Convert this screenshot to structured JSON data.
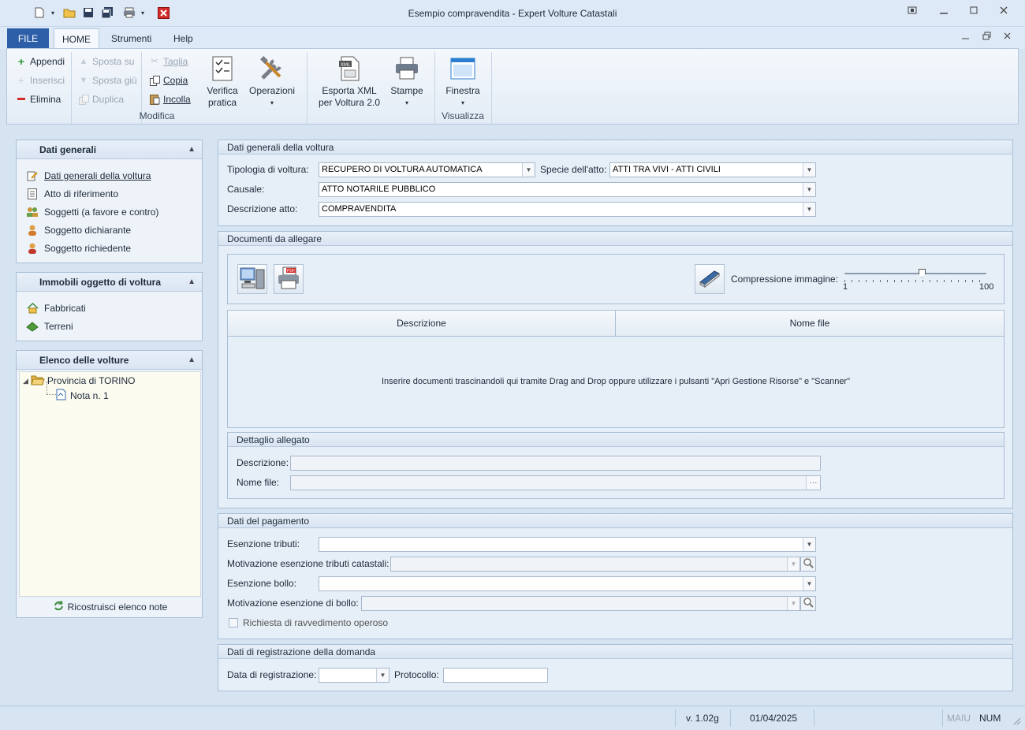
{
  "window": {
    "title": "Esempio compravendita - Expert Volture Catastali",
    "controls": [
      "restore-icon",
      "minimize-icon",
      "maximize-icon",
      "close-icon"
    ]
  },
  "tabs": [
    {
      "label": "FILE"
    },
    {
      "label": "HOME"
    },
    {
      "label": "Strumenti"
    },
    {
      "label": "Help"
    }
  ],
  "ribbon": {
    "appendi": "Appendi",
    "inserisci": "Inserisci",
    "elimina": "Elimina",
    "sposta_su": "Sposta su",
    "sposta_giu": "Sposta giù",
    "duplica": "Duplica",
    "taglia": "Taglia",
    "copia": "Copia",
    "incolla": "Incolla",
    "verifica": "Verifica\npratica",
    "operazioni": "Operazioni",
    "esporta": "Esporta XML\nper Voltura 2.0",
    "stampe": "Stampe",
    "finestra": "Finestra",
    "group_modifica": "Modifica",
    "group_visualizza": "Visualizza"
  },
  "sidebar": {
    "dati_generali": {
      "title": "Dati generali",
      "items": [
        "Dati generali della voltura",
        "Atto di riferimento",
        "Soggetti (a favore e contro)",
        "Soggetto dichiarante",
        "Soggetto richiedente"
      ]
    },
    "immobili": {
      "title": "Immobili oggetto di voltura",
      "items": [
        "Fabbricati",
        "Terreni"
      ]
    },
    "elenco": {
      "title": "Elenco delle volture",
      "tree_root": "Provincia di TORINO",
      "tree_child": "Nota n. 1",
      "rebuild": "Ricostruisci elenco note"
    }
  },
  "dati_generali_voltura": {
    "title": "Dati generali della voltura",
    "tipologia_label": "Tipologia di voltura:",
    "tipologia_value": "RECUPERO DI VOLTURA AUTOMATICA",
    "specie_label": "Specie dell'atto:",
    "specie_value": "ATTI TRA VIVI - ATTI CIVILI",
    "causale_label": "Causale:",
    "causale_value": "ATTO NOTARILE PUBBLICO",
    "descrizione_label": "Descrizione atto:",
    "descrizione_value": "COMPRAVENDITA"
  },
  "documenti": {
    "title": "Documenti da allegare",
    "compressione_label": "Compressione immagine:",
    "slider_min": "1",
    "slider_max": "100",
    "slider_value": 0.55,
    "col_descrizione": "Descrizione",
    "col_nome_file": "Nome file",
    "empty_message": "Inserire documenti trascinandoli qui tramite Drag and Drop oppure utilizzare i pulsanti \"Apri Gestione Risorse\" e \"Scanner\"",
    "dettaglio_title": "Dettaglio allegato",
    "dettaglio_descrizione": "Descrizione:",
    "dettaglio_nome_file": "Nome file:",
    "browse": "···"
  },
  "pagamento": {
    "title": "Dati del pagamento",
    "esenzione_tributi": "Esenzione tributi:",
    "motivazione_tributi": "Motivazione esenzione tributi catastali:",
    "esenzione_bollo": "Esenzione bollo:",
    "motivazione_bollo": "Motivazione esenzione di bollo:",
    "ravvedimento": "Richiesta di ravvedimento operoso"
  },
  "registrazione": {
    "title": "Dati di registrazione della domanda",
    "data_label": "Data di registrazione:",
    "protocollo_label": "Protocollo:"
  },
  "statusbar": {
    "version": "v. 1.02g",
    "date": "01/04/2025",
    "maiu": "MAIU",
    "num": "NUM"
  },
  "colors": {
    "file_tab": "#2d5fa8",
    "background": "#d6e4f2"
  }
}
